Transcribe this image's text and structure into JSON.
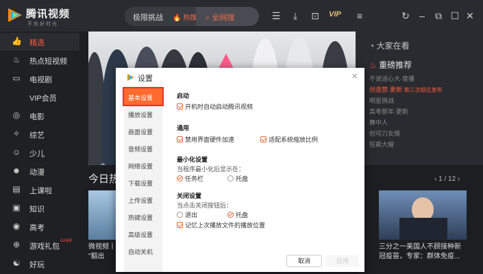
{
  "app": {
    "brand": "腾讯视频",
    "slogan": "不负好时光"
  },
  "search": {
    "text": "极限挑战",
    "hot": "🔥 热搜榜",
    "button": "全网搜"
  },
  "toolbar": {
    "vip": "VIP"
  },
  "sidebar": {
    "items": [
      {
        "label": "精选",
        "icon": "thumb-up-icon",
        "active": true
      },
      {
        "label": "热点短视频",
        "icon": "flame-icon"
      },
      {
        "label": "电视剧",
        "icon": "tv-icon"
      },
      {
        "label": "VIP会员",
        "icon": ""
      },
      {
        "label": "电影",
        "icon": "film-icon"
      },
      {
        "label": "综艺",
        "icon": "star-icon"
      },
      {
        "label": "少儿",
        "icon": "child-icon"
      },
      {
        "label": "动漫",
        "icon": "anime-icon"
      },
      {
        "label": "上课啦",
        "icon": "book-icon"
      },
      {
        "label": "知识",
        "icon": "knowledge-icon"
      },
      {
        "label": "高考",
        "icon": "exam-icon"
      },
      {
        "label": "游戏礼包",
        "icon": "gamepad-icon",
        "badge": "GAME"
      },
      {
        "label": "好玩",
        "icon": "fun-icon"
      }
    ]
  },
  "right_panel": {
    "header": "大家在看",
    "title": "重磅推荐",
    "lines": [
      {
        "text": "不说话心大·音播"
      },
      {
        "text": "创造营·更新",
        "hot": true,
        "sub": "第三次顺位发布"
      },
      {
        "text": "明星挑战"
      },
      {
        "text": "高考那年·更新"
      },
      {
        "text": "舞中人"
      },
      {
        "text": "创可刀女搜"
      },
      {
        "text": "狂飙大嫂"
      }
    ]
  },
  "section": {
    "title": "今日热",
    "pager": "1 / 12"
  },
  "cards": [
    {
      "line1": "微视频丨",
      "line2": "\"豁出"
    },
    {
      "line1": "三分之一美国人不顾接种新",
      "line2": "冠疫苗，专家：群体免疫..."
    }
  ],
  "dialog": {
    "title": "设置",
    "nav": [
      "基本设置",
      "播放设置",
      "画面设置",
      "音频设置",
      "网络设置",
      "下载设置",
      "上传设置",
      "热键设置",
      "高级设置",
      "自动关机"
    ],
    "sections": {
      "startup": {
        "title": "启动",
        "option": "开机时自动启动腾讯视频"
      },
      "general": {
        "title": "通用",
        "option1": "禁用界面硬件加速",
        "option2": "适配系统缩放比例"
      },
      "minimize": {
        "title": "最小化设置",
        "prompt": "当程序最小化后显示在：",
        "option1": "任务栏",
        "option2": "托盘"
      },
      "close": {
        "title": "关闭设置",
        "prompt": "当点击关闭按钮后：",
        "option1": "退出",
        "option2": "托盘",
        "remember": "记忆上次播放文件的播放位置"
      }
    },
    "cancel": "取消",
    "ok": "应用"
  }
}
